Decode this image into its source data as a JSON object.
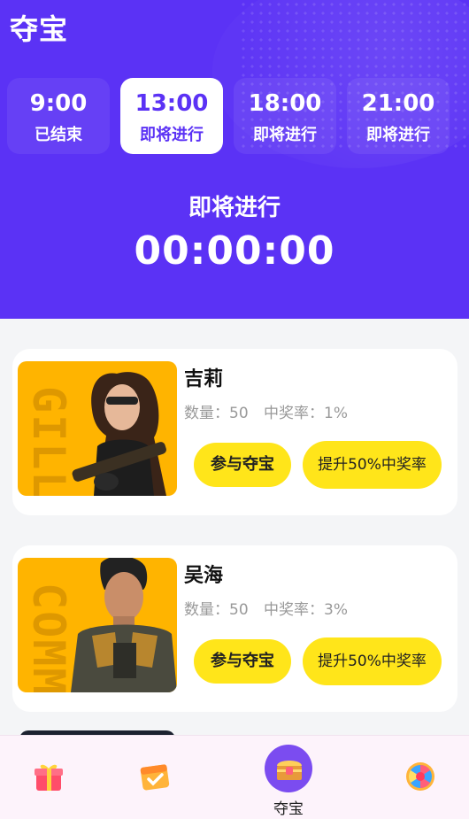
{
  "header": {
    "title": "夺宝",
    "countdown_label": "即将进行",
    "countdown": "00:00:00"
  },
  "slots": [
    {
      "time": "9:00",
      "status": "已结束",
      "active": false
    },
    {
      "time": "13:00",
      "status": "即将进行",
      "active": true
    },
    {
      "time": "18:00",
      "status": "即将进行",
      "active": false
    },
    {
      "time": "21:00",
      "status": "即将进行",
      "active": false
    }
  ],
  "items": [
    {
      "name": "吉莉",
      "quantity": "数量：50",
      "rate": "中奖率：1%",
      "bg_text": "GILL",
      "join_label": "参与夺宝",
      "boost_label": "提升50%中奖率"
    },
    {
      "name": "吴海",
      "quantity": "数量：50",
      "rate": "中奖率：3%",
      "bg_text": "COMM",
      "join_label": "参与夺宝",
      "boost_label": "提升50%中奖率"
    }
  ],
  "tabbar": {
    "tabs": [
      {
        "icon": "gift-box-icon",
        "label": ""
      },
      {
        "icon": "calendar-check-icon",
        "label": ""
      },
      {
        "icon": "treasure-chest-icon",
        "label": "夺宝"
      },
      {
        "icon": "prize-wheel-icon",
        "label": ""
      }
    ]
  },
  "colors": {
    "brand": "#5b32f5",
    "button": "#ffe51a",
    "portrait_bg": "#ffb400"
  }
}
